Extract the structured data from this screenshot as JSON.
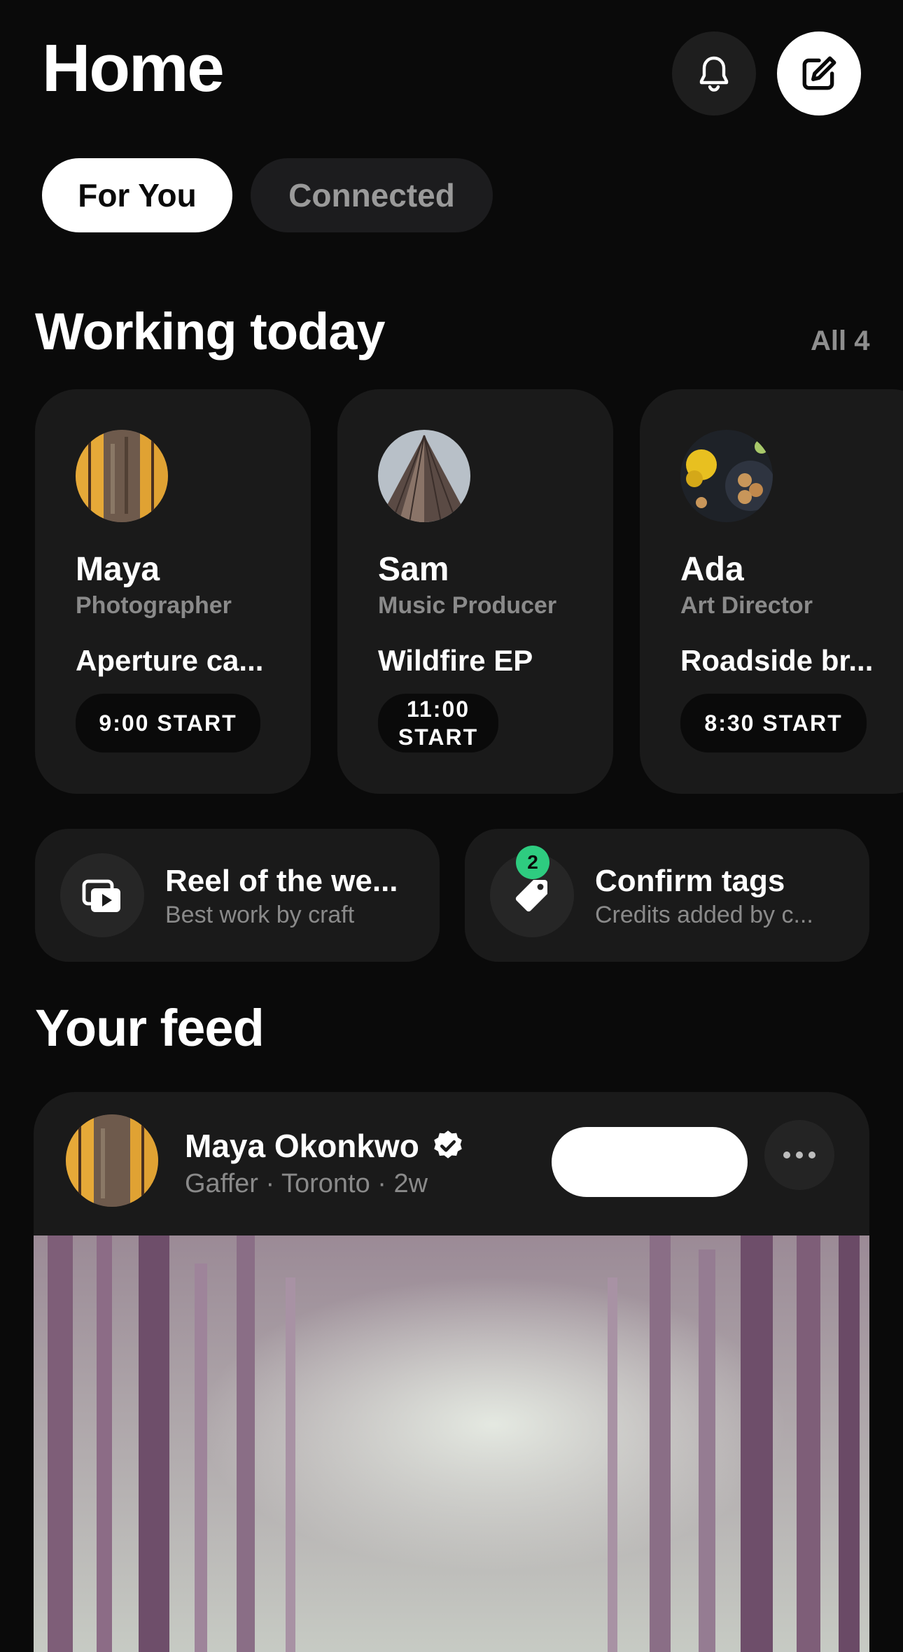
{
  "header": {
    "title": "Home",
    "icons": {
      "notifications": "bell-icon",
      "compose": "compose-icon"
    }
  },
  "tabs": [
    {
      "label": "For You",
      "selected": true
    },
    {
      "label": "Connected",
      "selected": false
    }
  ],
  "working_today": {
    "title": "Working today",
    "all_label": "All 4",
    "cards": [
      {
        "name": "Maya",
        "role": "Photographer",
        "project": "Aperture ca...",
        "start": "9:00 START"
      },
      {
        "name": "Sam",
        "role": "Music Producer",
        "project": "Wildfire EP",
        "start": "11:00 START"
      },
      {
        "name": "Ada",
        "role": "Art Director",
        "project": "Roadside br...",
        "start": "8:30 START"
      }
    ]
  },
  "actions": [
    {
      "title": "Reel of the we...",
      "subtitle": "Best work by craft",
      "icon": "reel-play-icon"
    },
    {
      "title": "Confirm tags",
      "subtitle": "Credits added by c...",
      "icon": "tag-icon",
      "badge": "2"
    }
  ],
  "feed": {
    "title": "Your feed",
    "post": {
      "author": "Maya Okonkwo",
      "verified": true,
      "meta": "Gaffer · Toronto · 2w"
    }
  },
  "colors": {
    "background": "#0a0a0a",
    "card": "#1a1a1a",
    "badge": "#2ecc80",
    "muted_text": "#8a8a8a"
  }
}
